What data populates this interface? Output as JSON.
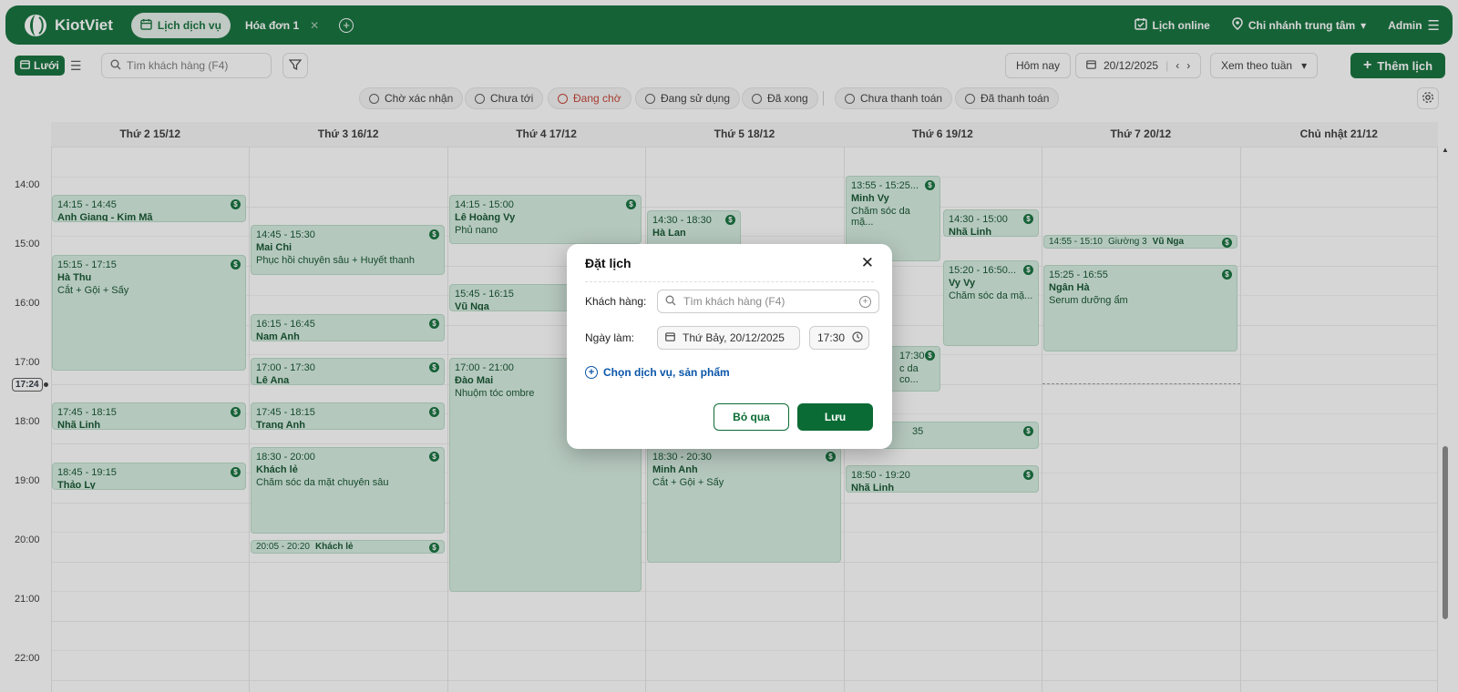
{
  "app": {
    "brand": "KiotViet"
  },
  "tabs": [
    {
      "label": "Lịch dịch vụ",
      "active": true
    },
    {
      "label": "Hóa đơn 1",
      "active": false
    }
  ],
  "header": {
    "online_label": "Lịch online",
    "branch_label": "Chi nhánh trung tâm",
    "user_label": "Admin"
  },
  "toolbar": {
    "grid_label": "Lưới",
    "search_placeholder": "Tìm khách hàng (F4)",
    "today_label": "Hôm nay",
    "date_value": "20/12/2025",
    "view_mode": "Xem theo tuần",
    "add_label": "Thêm lịch"
  },
  "status_filters": [
    {
      "label": "Chờ xác nhận"
    },
    {
      "label": "Chưa tới"
    },
    {
      "label": "Đang chờ",
      "color": "#c0392b"
    },
    {
      "label": "Đang sử dụng"
    },
    {
      "label": "Đã xong"
    },
    {
      "label": "Chưa thanh toán"
    },
    {
      "label": "Đã thanh toán"
    }
  ],
  "days": [
    "Thứ 2 15/12",
    "Thứ 3 16/12",
    "Thứ 4 17/12",
    "Thứ 5 18/12",
    "Thứ 6 19/12",
    "Thứ 7 20/12",
    "Chủ nhật 21/12"
  ],
  "hours": [
    "14:00",
    "15:00",
    "16:00",
    "17:00",
    "18:00",
    "19:00",
    "20:00",
    "21:00",
    "22:00"
  ],
  "now": "17:24",
  "events": {
    "e1": {
      "time": "14:15 - 14:45",
      "name": "Anh Giang - Kim Mã"
    },
    "e2": {
      "time": "15:15 - 17:15",
      "name": "Hà Thu",
      "service": "Cắt + Gội + Sấy"
    },
    "e3": {
      "time": "17:45 - 18:15",
      "name": "Nhã Linh"
    },
    "e4": {
      "time": "18:45 - 19:15",
      "name": "Thảo Ly"
    },
    "e5": {
      "time": "14:45 - 15:30",
      "name": "Mai Chi",
      "service": "Phục hồi chuyên sâu + Huyết thanh"
    },
    "e6": {
      "time": "16:15 - 16:45",
      "name": "Nam Anh"
    },
    "e7": {
      "time": "17:00 - 17:30",
      "name": "Lê Ana"
    },
    "e8": {
      "time": "17:45 - 18:15",
      "name": "Trang Anh"
    },
    "e9": {
      "time": "18:30 - 20:00",
      "name": "Khách lẻ",
      "service": "Chăm sóc da mặt chuyên sâu"
    },
    "e10": {
      "time": "20:05 - 20:20",
      "name": "Khách lẻ"
    },
    "e11": {
      "time": "14:15 - 15:00",
      "name": "Lê Hoàng Vy",
      "service": "Phủ nano"
    },
    "e12": {
      "time": "15:45 - 16:15",
      "name": "Vũ Nga"
    },
    "e13": {
      "time": "17:00 - 21:00",
      "name": "Đào Mai",
      "service": "Nhuộm tóc ombre"
    },
    "e14": {
      "time": "14:30 - 18:30",
      "name": "Hà Lan"
    },
    "e15": {
      "time": "18:30 - 20:30",
      "name": "Minh Anh",
      "service": "Cắt + Gội + Sấy"
    },
    "e16": {
      "time": "13:55 - 15:25...",
      "name": "Minh Vy",
      "service": "Chăm sóc da mặ..."
    },
    "e17": {
      "time": "14:30 - 15:00",
      "name": "Nhã Linh"
    },
    "e18": {
      "time": "15:20 - 16:50...",
      "name": "Vy Vy",
      "service": "Chăm sóc da mặ..."
    },
    "e19": {
      "time": "17:30",
      "service": "c da co..."
    },
    "e20": {
      "time": "35"
    },
    "e21": {
      "time": "18:50 - 19:20",
      "name": "Nhã Linh"
    },
    "e22": {
      "time": "14:55 - 15:10",
      "bed": "Giường 3",
      "name": "Vũ Nga"
    },
    "e23": {
      "time": "15:25 - 16:55",
      "name": "Ngân Hà",
      "service": "Serum dưỡng ẩm"
    }
  },
  "modal": {
    "title": "Đặt lịch",
    "customer_label": "Khách hàng:",
    "customer_placeholder": "Tìm khách hàng (F4)",
    "date_label": "Ngày làm:",
    "date_value": "Thứ Bảy, 20/12/2025",
    "time_value": "17:30",
    "choose_service": "Chọn dịch vụ, sản phẩm",
    "cancel_label": "Bỏ qua",
    "save_label": "Lưu"
  },
  "colors": {
    "brand": "#0a6b34",
    "event_bg": "#d5ede0",
    "waiting": "#c0392b",
    "link": "#0a55a8"
  }
}
